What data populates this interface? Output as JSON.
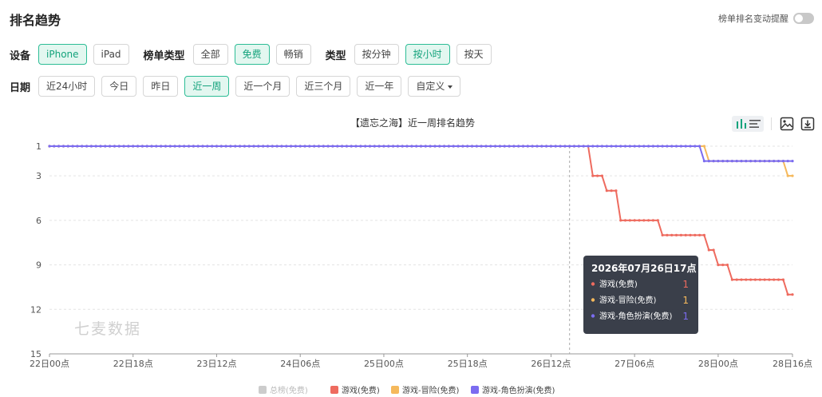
{
  "header": {
    "title": "排名趋势",
    "remind_label": "榜单排名变动提醒"
  },
  "filters": {
    "device_label": "设备",
    "devices": [
      {
        "label": "iPhone",
        "active": true
      },
      {
        "label": "iPad",
        "active": false
      }
    ],
    "list_type_label": "榜单类型",
    "list_types": [
      {
        "label": "全部",
        "active": false
      },
      {
        "label": "免费",
        "active": true
      },
      {
        "label": "畅销",
        "active": false
      }
    ],
    "kind_label": "类型",
    "kinds": [
      {
        "label": "按分钟",
        "active": false
      },
      {
        "label": "按小时",
        "active": true
      },
      {
        "label": "按天",
        "active": false
      }
    ],
    "date_label": "日期",
    "dates": [
      {
        "label": "近24小时",
        "active": false
      },
      {
        "label": "今日",
        "active": false
      },
      {
        "label": "昨日",
        "active": false
      },
      {
        "label": "近一周",
        "active": true
      },
      {
        "label": "近一个月",
        "active": false
      },
      {
        "label": "近三个月",
        "active": false
      },
      {
        "label": "近一年",
        "active": false
      }
    ],
    "custom_label": "自定义"
  },
  "toolbar": {
    "icons": [
      "bar-chart-icon",
      "list-icon",
      "image-icon",
      "download-icon"
    ]
  },
  "chart_data": {
    "type": "line",
    "title": "【遗忘之海】近一周排名趋势",
    "watermark": "七麦数据",
    "x_ticks": [
      "22日00点",
      "22日18点",
      "23日12点",
      "24日06点",
      "25日00点",
      "25日18点",
      "26日12点",
      "27日06点",
      "28日00点",
      "28日16点"
    ],
    "x_tick_hours": [
      0,
      18,
      36,
      54,
      72,
      90,
      108,
      126,
      144,
      160
    ],
    "x_range": [
      0,
      160
    ],
    "y_ticks": [
      1,
      3,
      6,
      9,
      12,
      15
    ],
    "y_range": [
      1,
      15
    ],
    "y_inverted": true,
    "grid": true,
    "legend_position": "bottom",
    "series": [
      {
        "name": "总榜(免费)",
        "color": "#cccccc",
        "enabled": false,
        "points": []
      },
      {
        "name": "游戏(免费)",
        "color": "#ee6b5f",
        "enabled": true,
        "points": [
          [
            0,
            1
          ],
          [
            116,
            1
          ],
          [
            117,
            3
          ],
          [
            119,
            3
          ],
          [
            120,
            4
          ],
          [
            122,
            4
          ],
          [
            123,
            6
          ],
          [
            131,
            6
          ],
          [
            132,
            7
          ],
          [
            141,
            7
          ],
          [
            142,
            8
          ],
          [
            143,
            8
          ],
          [
            144,
            9
          ],
          [
            146,
            9
          ],
          [
            147,
            10
          ],
          [
            158,
            10
          ],
          [
            159,
            11
          ],
          [
            160,
            11
          ]
        ]
      },
      {
        "name": "游戏-冒险(免费)",
        "color": "#f5b95c",
        "enabled": true,
        "points": [
          [
            0,
            1
          ],
          [
            141,
            1
          ],
          [
            142,
            2
          ],
          [
            158,
            2
          ],
          [
            159,
            3
          ],
          [
            160,
            3
          ]
        ]
      },
      {
        "name": "游戏-角色扮演(免费)",
        "color": "#7b6cf0",
        "enabled": true,
        "points": [
          [
            0,
            1
          ],
          [
            140,
            1
          ],
          [
            141,
            2
          ],
          [
            160,
            2
          ]
        ]
      }
    ],
    "tooltip": {
      "hour": 112,
      "title": "2026年07月26日17点",
      "rows": [
        {
          "name": "游戏(免费)",
          "value": "1",
          "color": "#ee6b5f"
        },
        {
          "name": "游戏-冒险(免费)",
          "value": "1",
          "color": "#f5b95c"
        },
        {
          "name": "游戏-角色扮演(免费)",
          "value": "1",
          "color": "#7b6cf0"
        }
      ]
    }
  }
}
